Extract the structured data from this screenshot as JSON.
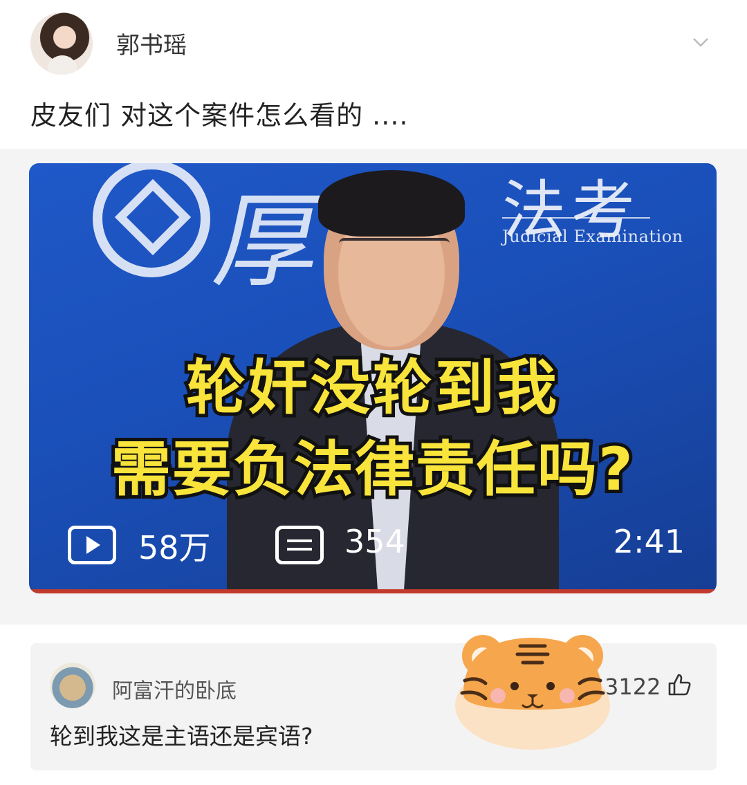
{
  "author": {
    "name": "郭书瑶",
    "avatar_icon": "user-avatar"
  },
  "post": {
    "text": "皮友们 对这个案件怎么看的  ...."
  },
  "video": {
    "brand_cn": "法考",
    "brand_bg_char": "厚",
    "brand_en": "Judicial Examination",
    "headline_line1": "轮奸没轮到我",
    "headline_line2": "需要负法律责任吗?",
    "views": "58万",
    "danmu_count": "354",
    "duration": "2:41",
    "accent_color": "#f8e43a",
    "bg_color": "#1f58c8"
  },
  "comment": {
    "user": "阿富汗的卧底",
    "text": "轮到我这是主语还是宾语?",
    "likes": "3122"
  }
}
